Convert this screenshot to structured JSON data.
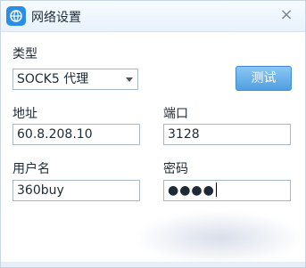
{
  "window": {
    "title": "网络设置",
    "close_glyph": "×",
    "app_icon": "network-globe-icon"
  },
  "form": {
    "type_label": "类型",
    "type_value": "SOCK5 代理",
    "test_button": "测试",
    "address_label": "地址",
    "address_value": "60.8.208.10",
    "port_label": "端口",
    "port_value": "3128",
    "username_label": "用户名",
    "username_value": "360buy",
    "password_label": "密码",
    "password_mask": "●●●●"
  },
  "colors": {
    "accent": "#4f9fe2",
    "title_bg": "#eef6fd"
  }
}
